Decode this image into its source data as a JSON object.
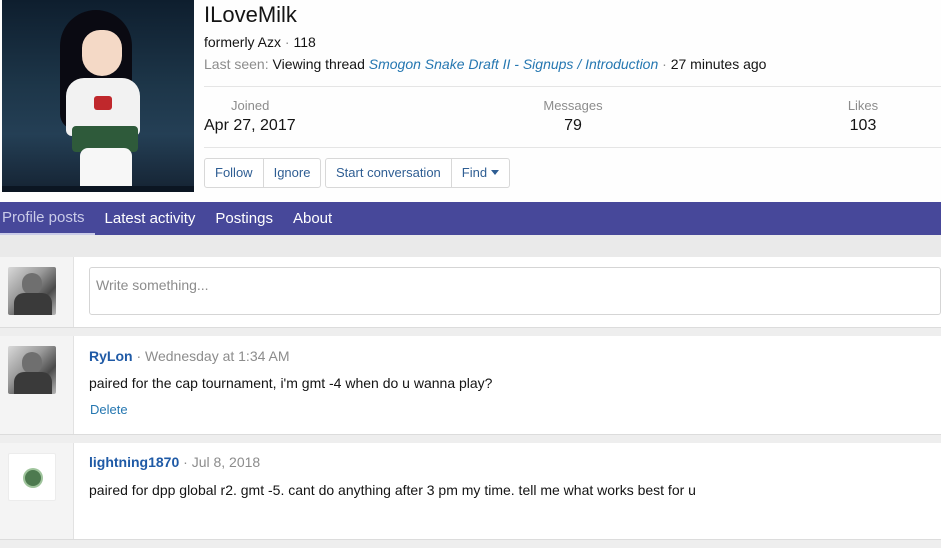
{
  "profile": {
    "username": "ILoveMilk",
    "formerly": "formerly Azx",
    "dot": " · ",
    "post_count": "118",
    "last_seen_label": "Last seen:",
    "last_seen_activity": "Viewing thread",
    "last_seen_thread": "Smogon Snake Draft II - Signups / Introduction",
    "last_seen_time": "27 minutes ago"
  },
  "stats": {
    "joined_label": "Joined",
    "joined_value": "Apr 27, 2017",
    "messages_label": "Messages",
    "messages_value": "79",
    "likes_label": "Likes",
    "likes_value": "103"
  },
  "actions": {
    "follow": "Follow",
    "ignore": "Ignore",
    "start_conversation": "Start conversation",
    "find": "Find"
  },
  "tabs": [
    {
      "label": "Profile posts"
    },
    {
      "label": "Latest activity"
    },
    {
      "label": "Postings"
    },
    {
      "label": "About"
    }
  ],
  "composer": {
    "placeholder": "Write something..."
  },
  "posts": [
    {
      "author": "RyLon",
      "time": "Wednesday at 1:34 AM",
      "body": "paired for the cap tournament, i'm gmt -4 when do u wanna play?",
      "delete": "Delete"
    },
    {
      "author": "lightning1870",
      "time": "Jul 8, 2018",
      "body": "paired for dpp global r2. gmt -5. cant do anything after 3 pm my time. tell me what works best for u"
    }
  ],
  "colors": {
    "nav_bar": "#47489a",
    "link": "#2577b1",
    "author_link": "#1f5aa6"
  }
}
